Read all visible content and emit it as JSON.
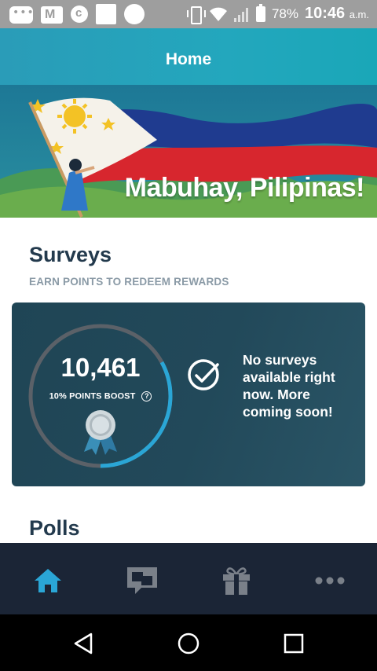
{
  "status_bar": {
    "left_icons": [
      "message-icon",
      "mail-icon",
      "c-circle-icon",
      "square-icon",
      "circle-icon"
    ],
    "battery": "78%",
    "time": "10:46",
    "ampm": "a.m."
  },
  "header": {
    "title": "Home"
  },
  "banner": {
    "headline": "Mabuhay, Pilipinas!"
  },
  "surveys": {
    "title": "Surveys",
    "subtitle": "EARN POINTS TO REDEEM REWARDS",
    "points": "10,461",
    "boost": "10% POINTS BOOST",
    "help": "?",
    "progress": 0.33,
    "message": "No surveys available right now. More coming soon!"
  },
  "polls": {
    "title": "Polls"
  },
  "bottom_nav": {
    "items": [
      "home-icon",
      "chat-icon",
      "gift-icon",
      "more-icon"
    ],
    "active": "home-icon"
  },
  "colors": {
    "accent": "#2aa6d6",
    "card_bg": "#22495a",
    "title_text": "#233a4d",
    "nav_bg": "#1b2536"
  }
}
